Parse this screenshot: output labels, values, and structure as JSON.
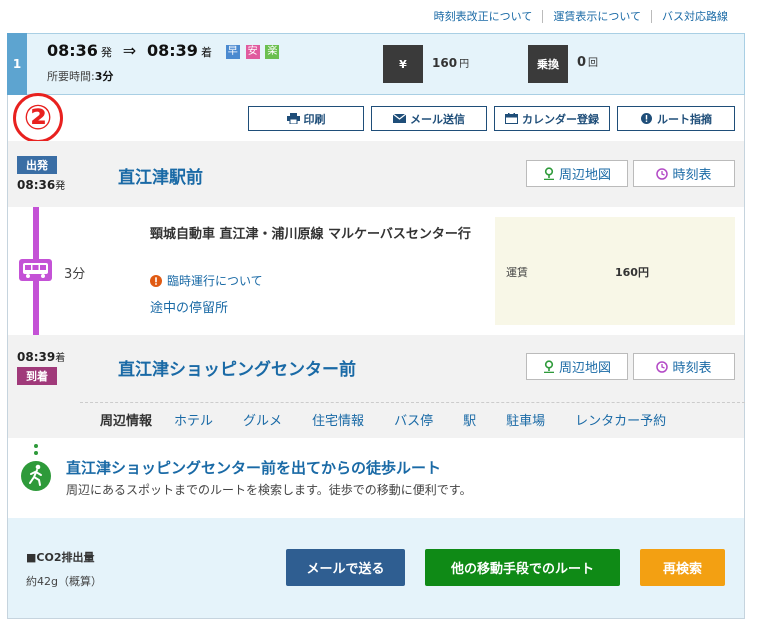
{
  "top_links": [
    "時刻表改正について",
    "運賃表示について",
    "バス対応路線"
  ],
  "route": {
    "number": "1",
    "dep_time": "08:36",
    "dep_suffix": "発",
    "arrow": "⇒",
    "arr_time": "08:39",
    "arr_suffix": "着",
    "badges": [
      "早",
      "安",
      "楽"
    ],
    "duration_label": "所要時間:",
    "duration_value": "3分",
    "fare_icon": "¥",
    "fare_value": "160",
    "fare_unit": "円",
    "transfer_label": "乗換",
    "transfer_value": "0",
    "transfer_unit": "回"
  },
  "circled_number": "②",
  "actions": [
    "印刷",
    "メール送信",
    "カレンダー登録",
    "ルート指摘"
  ],
  "departure": {
    "tag": "出発",
    "time": "08:36",
    "suffix": "発",
    "station": "直江津駅前",
    "map_button": "周辺地図",
    "timetable_button": "時刻表"
  },
  "ride": {
    "duration": "3分",
    "line_name": "頸城自動車 直江津・浦川原線 マルケーバスセンター行",
    "notice": "臨時運行について",
    "stops_link": "途中の停留所",
    "fare_label": "運賃",
    "fare_value": "160円"
  },
  "arrival": {
    "tag": "到着",
    "time": "08:39",
    "suffix": "着",
    "station": "直江津ショッピングセンター前",
    "map_button": "周辺地図",
    "timetable_button": "時刻表"
  },
  "nearby": {
    "label": "周辺情報",
    "links": [
      "ホテル",
      "グルメ",
      "住宅情報",
      "バス停",
      "駅",
      "駐車場",
      "レンタカー予約"
    ]
  },
  "walk": {
    "title": "直江津ショッピングセンター前を出てからの徒歩ルート",
    "subtitle": "周辺にあるスポットまでのルートを検索します。徒歩での移動に便利です。"
  },
  "bottom": {
    "co2_label": "■CO2排出量",
    "co2_value": "約42g（概算）",
    "mail_button": "メールで送る",
    "other_button": "他の移動手段でのルート",
    "research_button": "再検索"
  },
  "colors": {
    "link": "#1a6aa6",
    "mail_button": "#2f5e91",
    "other_button": "#0f8a16",
    "research_button": "#f3a012",
    "bus_line": "#c452d6"
  }
}
